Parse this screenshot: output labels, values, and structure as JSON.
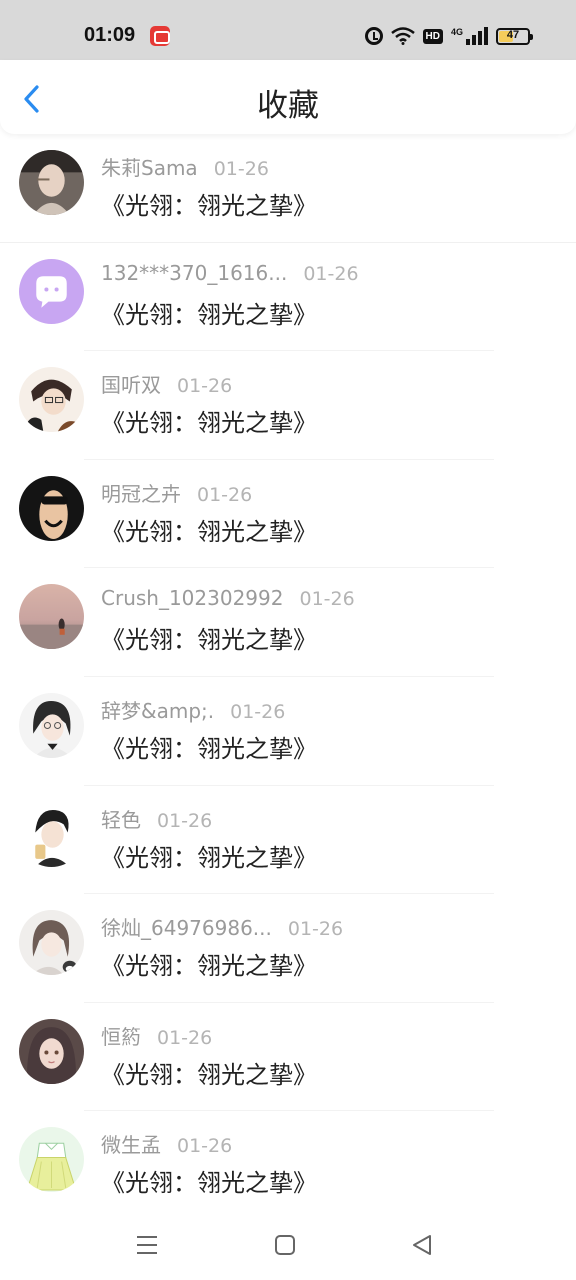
{
  "status_bar": {
    "time": "01:09",
    "battery": "47",
    "network_label": "4G",
    "hd_label": "HD"
  },
  "header": {
    "title": "收藏"
  },
  "items": [
    {
      "username": "朱莉Sama",
      "date": "01-26",
      "text": "《光翎：翎光之挚》"
    },
    {
      "username": "132***370_1616...",
      "date": "01-26",
      "text": "《光翎：翎光之挚》"
    },
    {
      "username": "国听双",
      "date": "01-26",
      "text": "《光翎：翎光之挚》"
    },
    {
      "username": "明冠之卉",
      "date": "01-26",
      "text": "《光翎：翎光之挚》"
    },
    {
      "username": "Crush_102302992",
      "date": "01-26",
      "text": "《光翎：翎光之挚》"
    },
    {
      "username": "辞梦&amp;.",
      "date": "01-26",
      "text": "《光翎：翎光之挚》"
    },
    {
      "username": "轻色",
      "date": "01-26",
      "text": "《光翎：翎光之挚》"
    },
    {
      "username": "徐灿_64976986...",
      "date": "01-26",
      "text": "《光翎：翎光之挚》"
    },
    {
      "username": "恒箹",
      "date": "01-26",
      "text": "《光翎：翎光之挚》"
    },
    {
      "username": "微生孟",
      "date": "01-26",
      "text": "《光翎：翎光之挚》"
    }
  ],
  "colors": {
    "accent": "#2a8cf0",
    "username": "#9a9a9a",
    "date": "#b4b4b4"
  }
}
